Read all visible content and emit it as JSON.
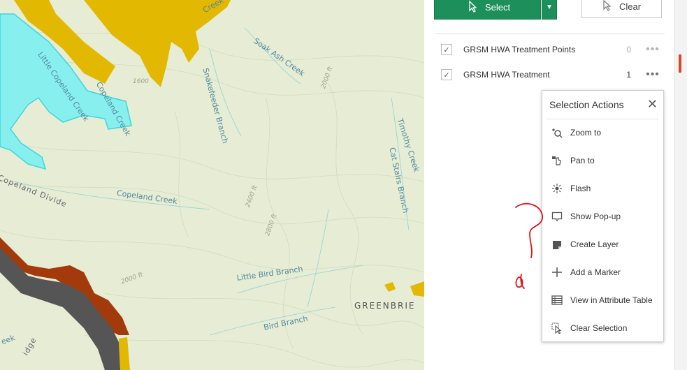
{
  "toolbar": {
    "select_label": "Select",
    "clear_label": "Clear",
    "select_icon": "select-cursor-icon",
    "clear_icon": "clear-selection-icon"
  },
  "layers": [
    {
      "name": "GRSM HWA Treatment Points",
      "count": "0",
      "checked": true,
      "more": "•••"
    },
    {
      "name": "GRSM HWA Treatment",
      "count": "1",
      "checked": true,
      "more": "•••"
    }
  ],
  "selection_actions": {
    "title": "Selection Actions",
    "close": "✕",
    "items": [
      {
        "label": "Zoom to",
        "icon": "zoom-to-icon"
      },
      {
        "label": "Pan to",
        "icon": "pan-to-icon"
      },
      {
        "label": "Flash",
        "icon": "flash-icon"
      },
      {
        "label": "Show Pop-up",
        "icon": "popup-icon"
      },
      {
        "label": "Create Layer",
        "icon": "create-layer-icon"
      },
      {
        "label": "Add a Marker",
        "icon": "add-marker-icon"
      },
      {
        "label": "View in Attribute Table",
        "icon": "attribute-table-icon"
      },
      {
        "label": "Clear Selection",
        "icon": "clear-selection-icon"
      }
    ]
  },
  "map_labels": {
    "creek_top": "Creek",
    "soak_ash": "Soak Ash Creek",
    "little_copeland": "Little Copeland Creek",
    "copeland_creek_hl": "Copeland Creek",
    "snakefeeder": "Snakefeeder Branch",
    "timothy": "Timothy Creek",
    "cat_stairs": "Cat Stairs Branch",
    "copeland_creek": "Copeland Creek",
    "copeland_divide": "Copeland Divide",
    "little_bird": "Little Bird Branch",
    "bird_branch": "Bird Branch",
    "greenbrier": "GREENBRIE",
    "ek": "eek",
    "ridge": "idge",
    "c1600": "1600",
    "c2000a": "2000 ft",
    "c2400": "2400 ft",
    "c2800": "2800 ft",
    "c2000b": "2000 ft"
  },
  "colors": {
    "accent_green": "#1d8f5a",
    "selected_polygon": "#7ff0ef",
    "forest_yellow": "#e2b800",
    "rust": "#a33a0c",
    "dark_gray": "#555555",
    "annotation_red": "#e0141a"
  }
}
